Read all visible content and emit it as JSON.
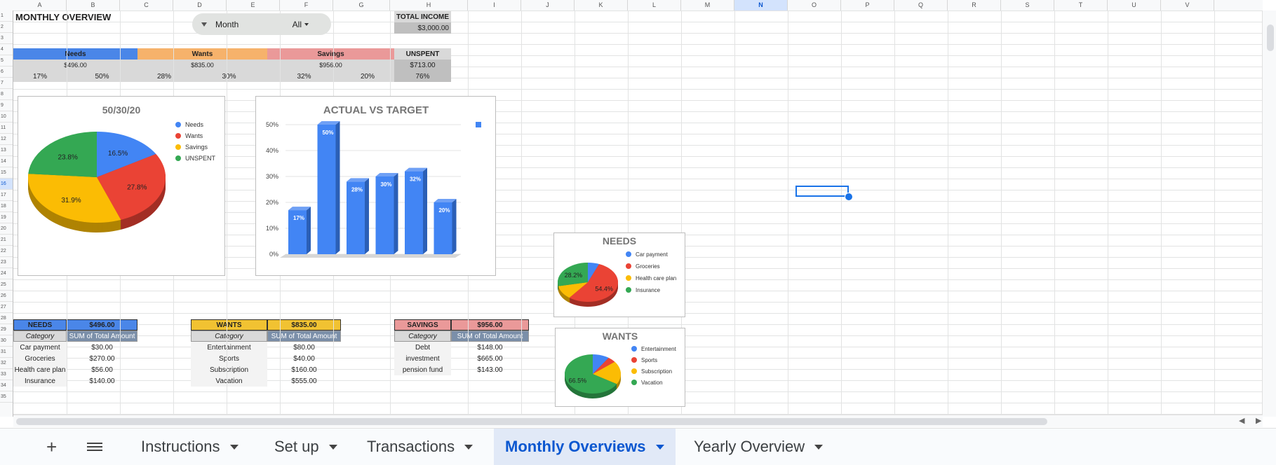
{
  "columns": [
    "A",
    "B",
    "C",
    "D",
    "E",
    "F",
    "G",
    "H",
    "I",
    "J",
    "K",
    "L",
    "M",
    "N",
    "O",
    "P",
    "Q",
    "R",
    "S",
    "T",
    "U",
    "V"
  ],
  "selected_column": "N",
  "selected_row": "16",
  "rows": [
    "1",
    "2",
    "3",
    "4",
    "5",
    "6",
    "7",
    "8",
    "9",
    "10",
    "11",
    "12",
    "13",
    "14",
    "15",
    "16",
    "17",
    "18",
    "19",
    "20",
    "21",
    "22",
    "23",
    "24",
    "25",
    "26",
    "27",
    "28",
    "29",
    "30",
    "31",
    "32",
    "33",
    "34",
    "35"
  ],
  "title": "MONTHLY OVERVIEW",
  "filter": {
    "label": "Month",
    "value": "All"
  },
  "income": {
    "label": "TOTAL INCOME",
    "value": "$3,000.00"
  },
  "summary": {
    "needs": {
      "label": "Needs",
      "amount": "$496.00",
      "actual_pct": "17%",
      "target_pct": "50%",
      "color": "#4a86e8"
    },
    "wants": {
      "label": "Wants",
      "amount": "$835.00",
      "actual_pct": "28%",
      "target_pct": "30%",
      "color": "#f6b26b"
    },
    "savings": {
      "label": "Savings",
      "amount": "$956.00",
      "actual_pct": "32%",
      "target_pct": "20%",
      "color": "#ea9999"
    },
    "unspent": {
      "label": "UNSPENT",
      "amount": "$713.00",
      "pct": "76%"
    }
  },
  "chart_data": [
    {
      "type": "pie",
      "title": "50/30/20",
      "labels": [
        "Needs",
        "Wants",
        "Savings",
        "UNSPENT"
      ],
      "values": [
        16.5,
        27.8,
        31.9,
        23.8
      ],
      "value_labels": [
        "16.5%",
        "27.8%",
        "31.9%",
        "23.8%"
      ],
      "colors": [
        "#4285f4",
        "#ea4335",
        "#fbbc04",
        "#34a853"
      ],
      "legend": "right"
    },
    {
      "type": "bar",
      "title": "ACTUAL VS TARGET",
      "categories": [
        "",
        "",
        "",
        "",
        "",
        ""
      ],
      "values": [
        17,
        50,
        28,
        30,
        32,
        20
      ],
      "data_labels": [
        "17%",
        "50%",
        "28%",
        "30%",
        "32%",
        "20%"
      ],
      "yticks": [
        "0%",
        "10%",
        "20%",
        "30%",
        "40%",
        "50%"
      ],
      "ylim": [
        0,
        50
      ],
      "color": "#4285f4"
    },
    {
      "type": "pie",
      "title": "NEEDS",
      "labels": [
        "Car payment",
        "Groceries",
        "Health care plan",
        "Insurance"
      ],
      "values": [
        6.1,
        54.4,
        11.3,
        28.2
      ],
      "value_labels": [
        "",
        "54.4%",
        "",
        "28.2%"
      ],
      "colors": [
        "#4285f4",
        "#ea4335",
        "#fbbc04",
        "#34a853"
      ],
      "legend": "right"
    },
    {
      "type": "pie",
      "title": "WANTS",
      "labels": [
        "Entertainment",
        "Sports",
        "Subscription",
        "Vacation"
      ],
      "values": [
        9.6,
        4.8,
        19.2,
        66.5
      ],
      "value_labels": [
        "",
        "",
        "",
        "66.5%"
      ],
      "colors": [
        "#4285f4",
        "#ea4335",
        "#fbbc04",
        "#34a853"
      ],
      "legend": "right"
    }
  ],
  "needs_table": {
    "title": "NEEDS",
    "total": "$496.00",
    "col1": "Category",
    "col2": "SUM of Total Amount",
    "rows": [
      {
        "cat": "Car payment",
        "amt": "$30.00"
      },
      {
        "cat": "Groceries",
        "amt": "$270.00"
      },
      {
        "cat": "Health care plan",
        "amt": "$56.00"
      },
      {
        "cat": "Insurance",
        "amt": "$140.00"
      }
    ]
  },
  "wants_table": {
    "title": "WANTS",
    "total": "$835.00",
    "col1": "Category",
    "col2": "SUM of Total Amount",
    "rows": [
      {
        "cat": "Entertainment",
        "amt": "$80.00"
      },
      {
        "cat": "Sports",
        "amt": "$40.00"
      },
      {
        "cat": "Subscription",
        "amt": "$160.00"
      },
      {
        "cat": "Vacation",
        "amt": "$555.00"
      }
    ]
  },
  "savings_table": {
    "title": "SAVINGS",
    "total": "$956.00",
    "col1": "Category",
    "col2": "SUM of Total Amount",
    "rows": [
      {
        "cat": "Debt",
        "amt": "$148.00"
      },
      {
        "cat": "investment",
        "amt": "$665.00"
      },
      {
        "cat": "pension fund",
        "amt": "$143.00"
      }
    ]
  },
  "tabs": {
    "add_icon": "plus-icon",
    "menu_icon": "menu-icon",
    "items": [
      {
        "label": "Instructions"
      },
      {
        "label": "Set up"
      },
      {
        "label": "Transactions"
      },
      {
        "label": "Monthly Overviews"
      },
      {
        "label": "Yearly Overview"
      }
    ],
    "active": 3
  }
}
